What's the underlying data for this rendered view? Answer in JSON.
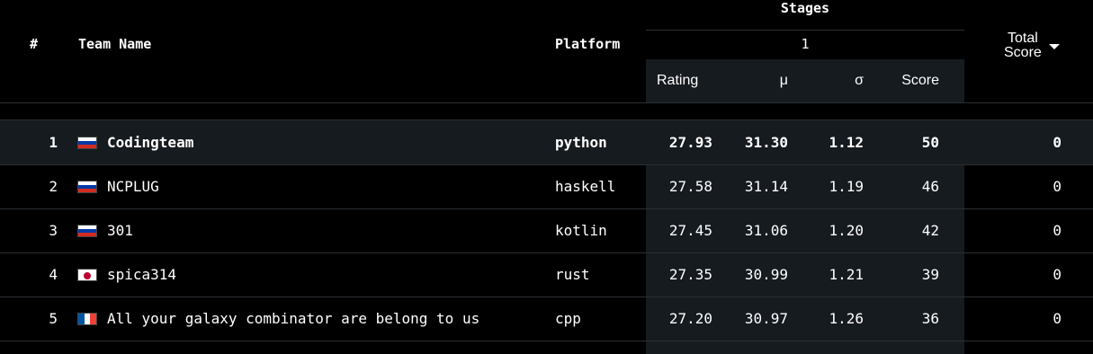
{
  "header": {
    "rank": "#",
    "team_name": "Team Name",
    "platform": "Platform",
    "stages": "Stages",
    "stage_number": "1",
    "rating": "Rating",
    "mu": "μ",
    "sigma": "σ",
    "score": "Score",
    "total_score_line1": "Total",
    "total_score_line2": "Score"
  },
  "rows": [
    {
      "rank": "1",
      "flag": "russia-flag",
      "team": "Codingteam",
      "platform": "python",
      "rating": "27.93",
      "mu": "31.30",
      "sigma": "1.12",
      "score": "50",
      "total": "0"
    },
    {
      "rank": "2",
      "flag": "russia-flag",
      "team": "NCPLUG",
      "platform": "haskell",
      "rating": "27.58",
      "mu": "31.14",
      "sigma": "1.19",
      "score": "46",
      "total": "0"
    },
    {
      "rank": "3",
      "flag": "russia-flag",
      "team": "301",
      "platform": "kotlin",
      "rating": "27.45",
      "mu": "31.06",
      "sigma": "1.20",
      "score": "42",
      "total": "0"
    },
    {
      "rank": "4",
      "flag": "japan-flag",
      "team": "spica314",
      "platform": "rust",
      "rating": "27.35",
      "mu": "30.99",
      "sigma": "1.21",
      "score": "39",
      "total": "0"
    },
    {
      "rank": "5",
      "flag": "france-flag",
      "team": "All your galaxy combinator are belong to us",
      "platform": "cpp",
      "rating": "27.20",
      "mu": "30.97",
      "sigma": "1.26",
      "score": "36",
      "total": "0"
    }
  ],
  "colors": {
    "background": "#000000",
    "stage_column_bg": "#161b20",
    "highlight_row_bg": "#161b20",
    "divider": "#2b2f33"
  }
}
